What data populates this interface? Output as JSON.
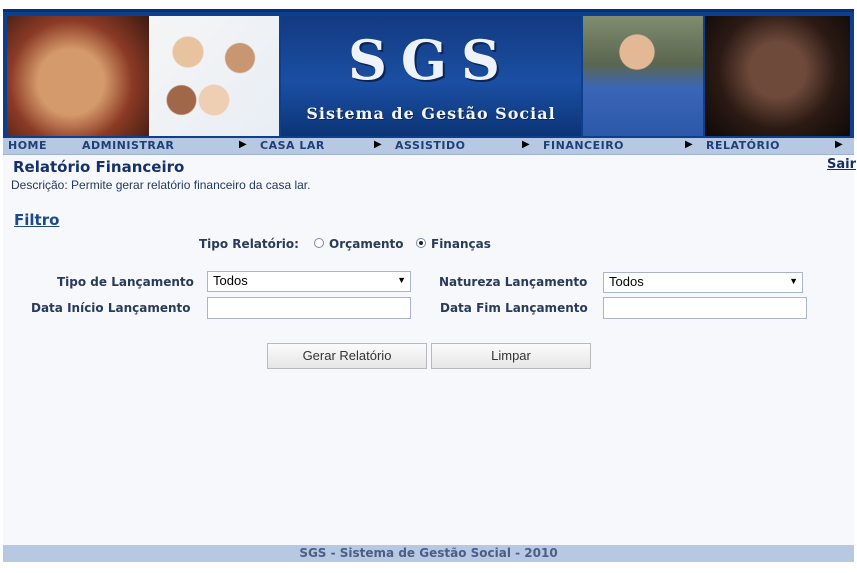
{
  "header": {
    "logo": "SGS",
    "subtitle": "Sistema de Gestão Social"
  },
  "nav": {
    "items": [
      "HOME",
      "ADMINISTRAR",
      "CASA LAR",
      "ASSISTIDO",
      "FINANCEIRO",
      "RELATÓRIO"
    ],
    "arrow_icon": "triangle-right-icon"
  },
  "page": {
    "title": "Relatório Financeiro",
    "description": "Descrição: Permite gerar relatório financeiro da casa lar.",
    "logout": "Sair"
  },
  "filter": {
    "heading": "Filtro",
    "report_type_label": "Tipo Relatório:",
    "option_budget": "Orçamento",
    "option_finance": "Finanças",
    "selected": "Finanças",
    "launch_type_label": "Tipo de Lançamento",
    "launch_type_value": "Todos",
    "nature_label": "Natureza Lançamento",
    "nature_value": "Todos",
    "start_date_label": "Data Início Lançamento",
    "start_date_value": "",
    "end_date_label": "Data Fim Lançamento",
    "end_date_value": ""
  },
  "actions": {
    "generate": "Gerar Relatório",
    "clear": "Limpar"
  },
  "footer": {
    "text": "SGS - Sistema de Gestão Social - 2010"
  },
  "colors": {
    "banner": "#0d3f8f",
    "nav_bg": "#b7c9e2",
    "nav_text": "#1f3f78",
    "title_text": "#16306a",
    "page_bg": "#f6f8fb"
  }
}
